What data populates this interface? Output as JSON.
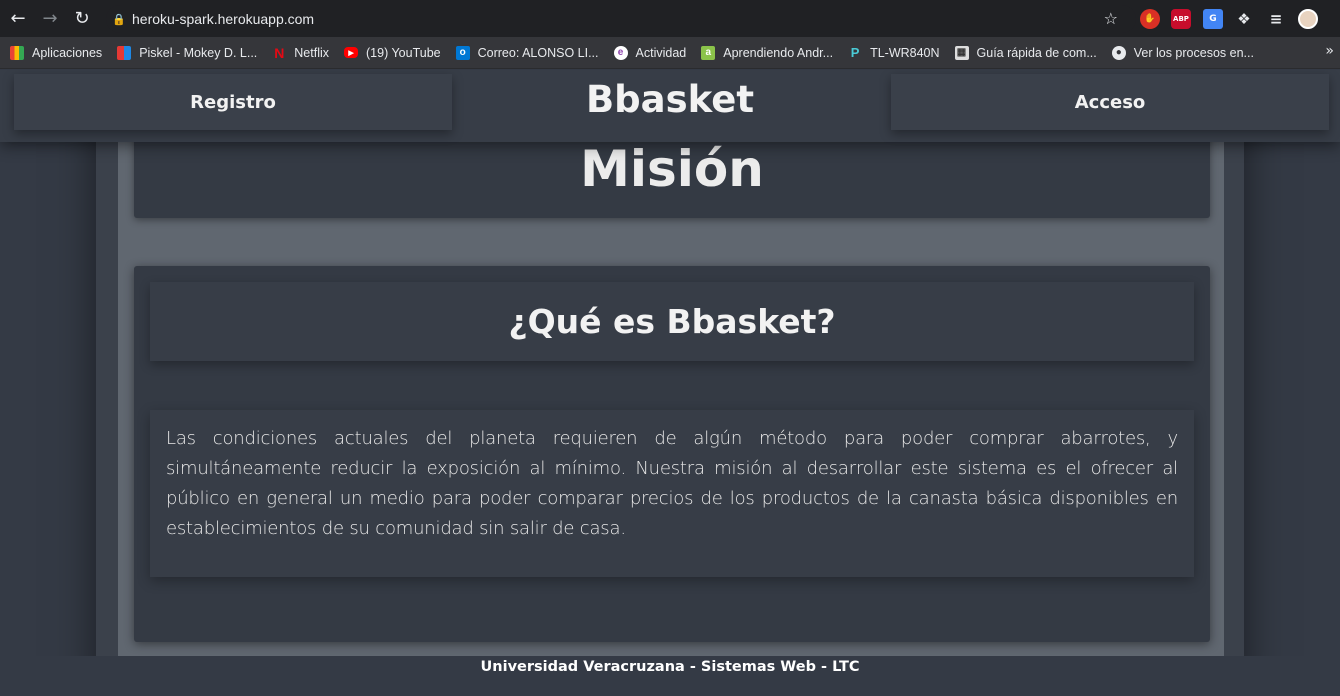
{
  "browser": {
    "url": "heroku-spark.herokuapp.com",
    "bookmarks": [
      {
        "label": "Aplicaciones",
        "icon": "apps-grid-icon",
        "color": "#e8eaed"
      },
      {
        "label": "Piskel - Mokey D. L...",
        "icon": "piskel-icon",
        "color": "#4caf50"
      },
      {
        "label": "Netflix",
        "icon": "netflix-icon",
        "color": "#e50914"
      },
      {
        "label": "(19) YouTube",
        "icon": "youtube-icon",
        "color": "#ff0000"
      },
      {
        "label": "Correo: ALONSO LI...",
        "icon": "outlook-icon",
        "color": "#0078d4"
      },
      {
        "label": "Actividad",
        "icon": "activity-icon",
        "color": "#8e44ad"
      },
      {
        "label": "Aprendiendo Andr...",
        "icon": "android-icon",
        "color": "#8bc34a"
      },
      {
        "label": "TL-WR840N",
        "icon": "tplink-icon",
        "color": "#4acbd6"
      },
      {
        "label": "Guía rápida de com...",
        "icon": "document-icon",
        "color": "#dddddd"
      },
      {
        "label": "Ver los procesos en...",
        "icon": "globe-icon",
        "color": "#e8eaed"
      }
    ]
  },
  "header": {
    "left_label": "Registro",
    "title": "Bbasket",
    "right_label": "Acceso"
  },
  "mision": {
    "title": "Misión"
  },
  "content": {
    "heading": "¿Qué es Bbasket?",
    "paragraph": "Las condiciones actuales del planeta requieren de algún método para poder comprar abarrotes, y simultáneamente reducir la exposición al mínimo. Nuestra misión al desarrollar este sistema es el ofrecer al público en general un medio para poder comparar precios de los productos de la canasta básica disponibles en establecimientos de su comunidad sin salir de casa."
  },
  "footer": {
    "text": "Universidad Veracruzana - Sistemas Web - LTC"
  }
}
